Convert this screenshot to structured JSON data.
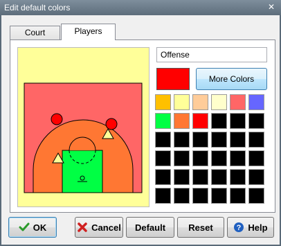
{
  "window": {
    "title": "Edit default colors",
    "close_glyph": "✕"
  },
  "tabs": [
    {
      "label": "Court"
    },
    {
      "label": "Players"
    }
  ],
  "players": {
    "name_value": "Offense",
    "current_color": "#ff0000",
    "more_colors_label": "More Colors",
    "palette": [
      "#ffc000",
      "#ffff99",
      "#ffcc99",
      "#ffffcc",
      "#ff6666",
      "#6666ff",
      "#00ff44",
      "#ff7733",
      "#ff0000",
      "#000000",
      "#000000",
      "#000000",
      "#000000",
      "#000000",
      "#000000",
      "#000000",
      "#000000",
      "#000000",
      "#000000",
      "#000000",
      "#000000",
      "#000000",
      "#000000",
      "#000000",
      "#000000",
      "#000000",
      "#000000",
      "#000000",
      "#000000",
      "#000000",
      "#000000",
      "#000000",
      "#000000",
      "#000000",
      "#000000",
      "#000000"
    ],
    "court_colors": {
      "background": "#ffff99",
      "court_floor": "#ff6666",
      "three_point_area": "#ff7733",
      "key": "#00ff44",
      "offense_player": "#ff0000",
      "defense_player": "#ffff99"
    }
  },
  "buttons": {
    "ok": "OK",
    "cancel": "Cancel",
    "default": "Default",
    "reset": "Reset",
    "help": "Help"
  }
}
